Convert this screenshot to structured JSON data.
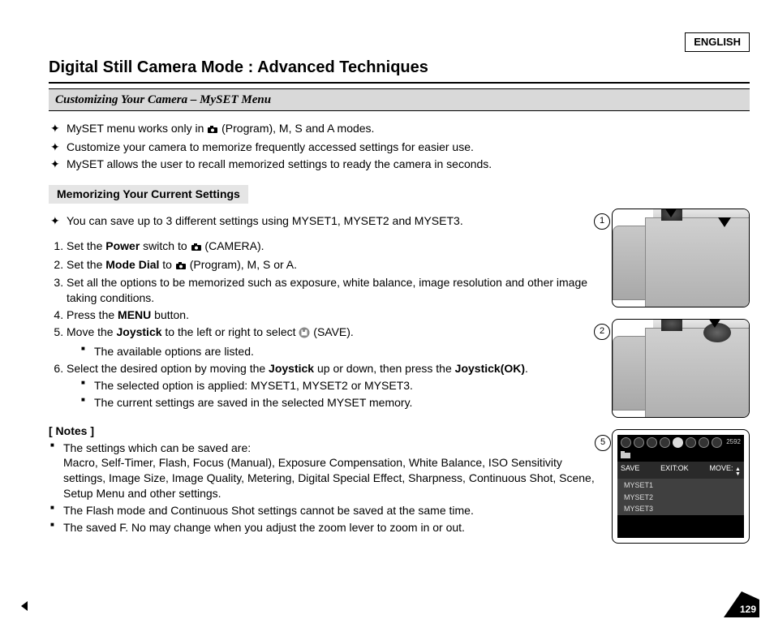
{
  "language_label": "ENGLISH",
  "page_title": "Digital Still Camera Mode : Advanced Techniques",
  "subtitle": "Customizing Your Camera – MySET Menu",
  "intro_bullets": [
    "MySET menu works only in  (Program), M, S and A modes.",
    "Customize your camera to memorize frequently accessed settings for easier use.",
    "MySET allows the user to recall memorized settings to ready the camera in seconds."
  ],
  "memo_heading": "Memorizing Your Current Settings",
  "memo_bullet": "You can save up to 3 different settings using MYSET1, MYSET2 and MYSET3.",
  "steps": {
    "s1_a": "Set the ",
    "s1_b": "Power",
    "s1_c": " switch to ",
    "s1_d": " (CAMERA).",
    "s2_a": "Set the ",
    "s2_b": "Mode Dial",
    "s2_c": " to ",
    "s2_d": " (Program), M, S or A.",
    "s3": "Set all the options to be memorized such as exposure, white balance, image resolution and other image taking conditions.",
    "s4_a": "Press the ",
    "s4_b": "MENU",
    "s4_c": " button.",
    "s5_a": "Move the ",
    "s5_b": "Joystick",
    "s5_c": " to the left or right to select  ",
    "s5_d": " (SAVE).",
    "s5_sub": "The available options are listed.",
    "s6_a": "Select the desired option by moving the ",
    "s6_b": "Joystick",
    "s6_c": " up or down, then press the ",
    "s6_d": "Joystick(OK)",
    "s6_e": ".",
    "s6_sub1": "The selected option is applied: MYSET1, MYSET2 or MYSET3.",
    "s6_sub2": "The current settings are saved in the selected MYSET memory."
  },
  "notes_heading": "[ Notes ]",
  "notes": {
    "n1a": "The settings which can be saved are:",
    "n1b": "Macro, Self-Timer, Flash, Focus (Manual), Exposure Compensation, White Balance, ISO Sensitivity settings, Image Size, Image Quality, Metering, Digital Special Effect, Sharpness, Continuous Shot, Scene, Setup Menu and other settings.",
    "n2": "The Flash mode and Continuous Shot settings cannot be saved at the same time.",
    "n3": "The saved F. No may change when you adjust the zoom lever to zoom in or out."
  },
  "lcd": {
    "resolution": "2592",
    "row_left": "SAVE",
    "row_mid": "EXIT:OK",
    "row_right": "MOVE:",
    "items": [
      "MYSET1",
      "MYSET2",
      "MYSET3"
    ]
  },
  "illus_numbers": {
    "a": "1",
    "b": "2",
    "c": "5"
  },
  "page_number": "129"
}
